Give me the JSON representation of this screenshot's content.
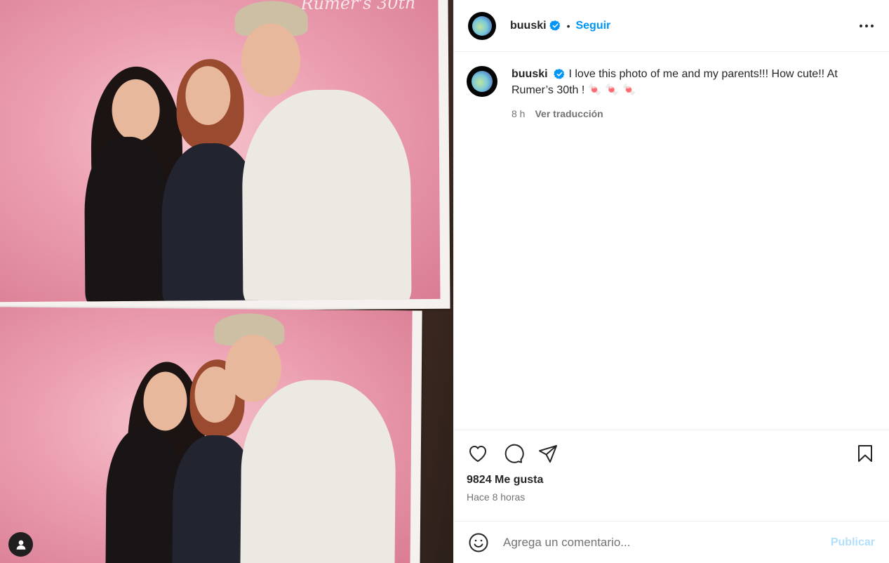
{
  "media": {
    "watermark": "Rumer's 30th"
  },
  "post": {
    "username": "buuski",
    "follow_label": "Seguir",
    "separator": "•",
    "caption_text": "I love this photo of me and my parents!!! How cute!! At Rumer’s 30th ! 🍬 🍬 🍬",
    "caption_age": "8 h",
    "translate_label": "Ver traducción",
    "likes": "9824 Me gusta",
    "posted_time": "Hace 8 horas",
    "comment_placeholder": "Agrega un comentario...",
    "publish_label": "Publicar"
  },
  "colors": {
    "accent": "#0095f6",
    "publish_disabled": "#b2dffc",
    "verified": "#0095f6"
  }
}
